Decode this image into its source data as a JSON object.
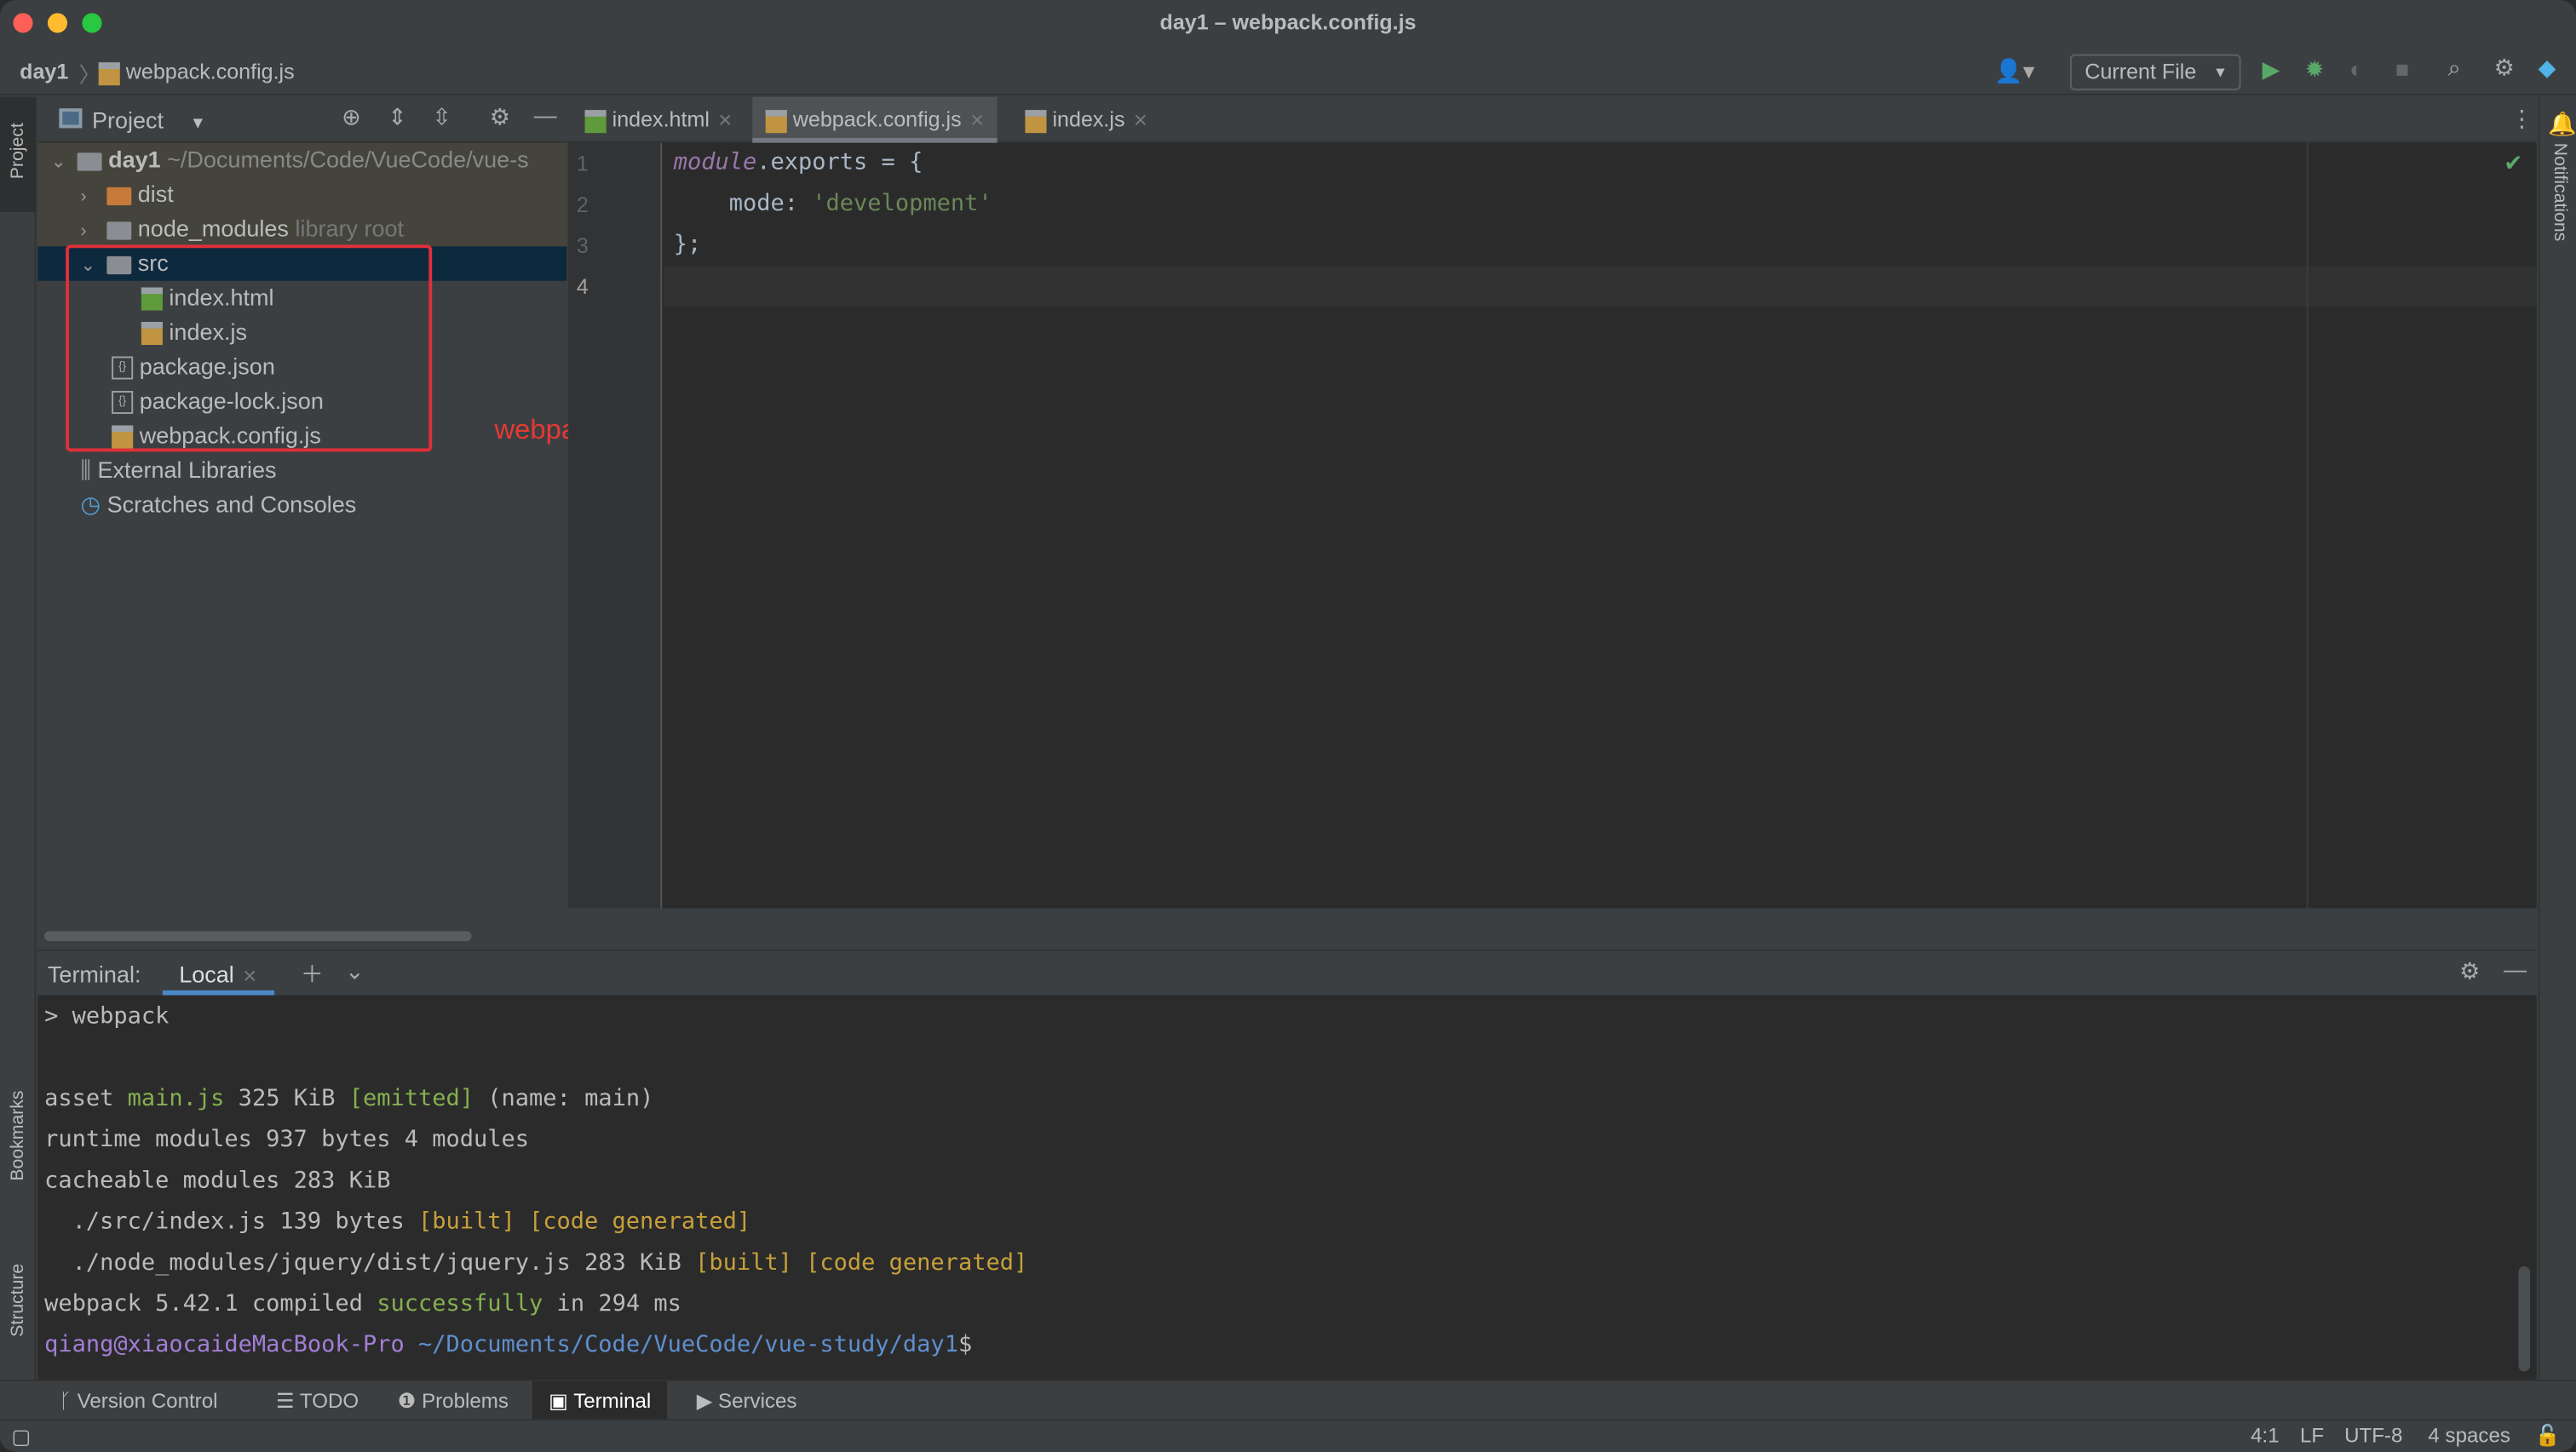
{
  "window": {
    "title": "day1 – webpack.config.js"
  },
  "breadcrumb": {
    "project": "day1",
    "file": "webpack.config.js"
  },
  "run_config": {
    "label": "Current File"
  },
  "sidebar_left": {
    "project": "Project",
    "bookmarks": "Bookmarks",
    "structure": "Structure"
  },
  "sidebar_right": {
    "notifications": "Notifications"
  },
  "project_panel": {
    "title": "Project",
    "root": {
      "name": "day1",
      "path": "~/Documents/Code/VueCode/vue-s"
    },
    "items": [
      {
        "name": "dist"
      },
      {
        "name": "node_modules",
        "hint": "library root"
      },
      {
        "name": "src"
      },
      {
        "name": "index.html"
      },
      {
        "name": "index.js"
      },
      {
        "name": "package.json"
      },
      {
        "name": "package-lock.json"
      },
      {
        "name": "webpack.config.js"
      },
      {
        "name": "External Libraries"
      },
      {
        "name": "Scratches and Consoles"
      }
    ]
  },
  "annotation": {
    "text": "webpack要和src同级目录",
    "color": "#e53935"
  },
  "tabs": [
    {
      "label": "index.html"
    },
    {
      "label": "webpack.config.js",
      "active": true
    },
    {
      "label": "index.js"
    }
  ],
  "editor": {
    "line_numbers": [
      "1",
      "2",
      "3",
      "4"
    ],
    "lines": [
      {
        "kw": "module",
        "rest": ".exports = {"
      },
      {
        "key": "    mode: ",
        "str": "'development'"
      },
      {
        "text": "};"
      },
      {
        "text": ""
      }
    ]
  },
  "terminal": {
    "label": "Terminal:",
    "tab": "Local",
    "lines": {
      "l1": "> webpack",
      "l2a": "asset ",
      "l2b": "main.js",
      "l2c": " 325 KiB ",
      "l2d": "[emitted]",
      "l2e": " (name: main)",
      "l3": "runtime modules 937 bytes 4 modules",
      "l4": "cacheable modules 283 KiB",
      "l5a": "  ./src/index.js 139 bytes ",
      "l5b": "[built] [code generated]",
      "l6a": "  ./node_modules/jquery/dist/jquery.js 283 KiB ",
      "l6b": "[built] [code generated]",
      "l7a": "webpack 5.42.1 compiled ",
      "l7b": "successfully",
      "l7c": " in 294 ms",
      "l8a": "qiang@xiaocaideMacBook-Pro",
      "l8b": " ~/Documents/Code/VueCode/vue-study/day1",
      "l8c": "$"
    }
  },
  "tool_windows": [
    "Version Control",
    "TODO",
    "Problems",
    "Terminal",
    "Services"
  ],
  "status": {
    "position": "4:1",
    "line_sep": "LF",
    "encoding": "UTF-8",
    "indent": "4 spaces"
  }
}
